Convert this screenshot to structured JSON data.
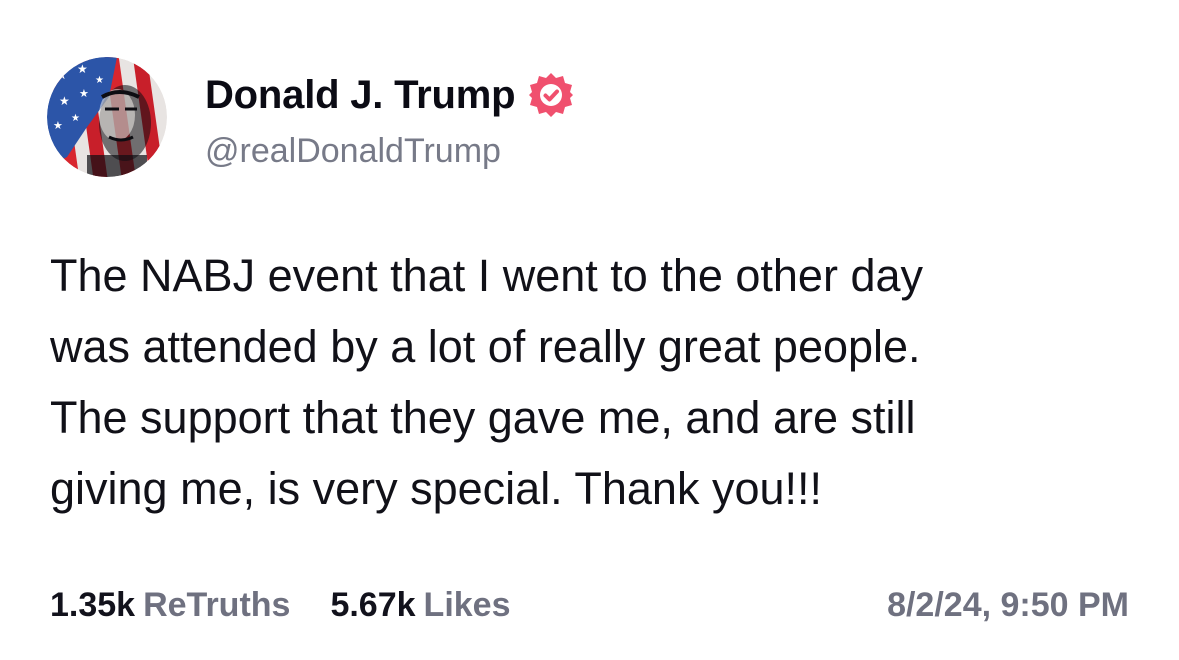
{
  "author": {
    "display_name": "Donald J. Trump",
    "handle": "@realDonaldTrump",
    "verified": true,
    "verified_badge_color": "#f0506e",
    "avatar_icon": "flag-portrait-avatar"
  },
  "post": {
    "lines": [
      "The NABJ event that I went to the other day",
      "was attended by a lot of really great people.",
      "The support that they gave me, and are still",
      "giving me, is very special. Thank you!!!"
    ]
  },
  "stats": {
    "retruths_count": "1.35k",
    "retruths_label": "ReTruths",
    "likes_count": "5.67k",
    "likes_label": "Likes"
  },
  "timestamp": "8/2/24, 9:50 PM",
  "colors": {
    "text": "#111118",
    "muted": "#6f7180",
    "background": "#ffffff"
  }
}
